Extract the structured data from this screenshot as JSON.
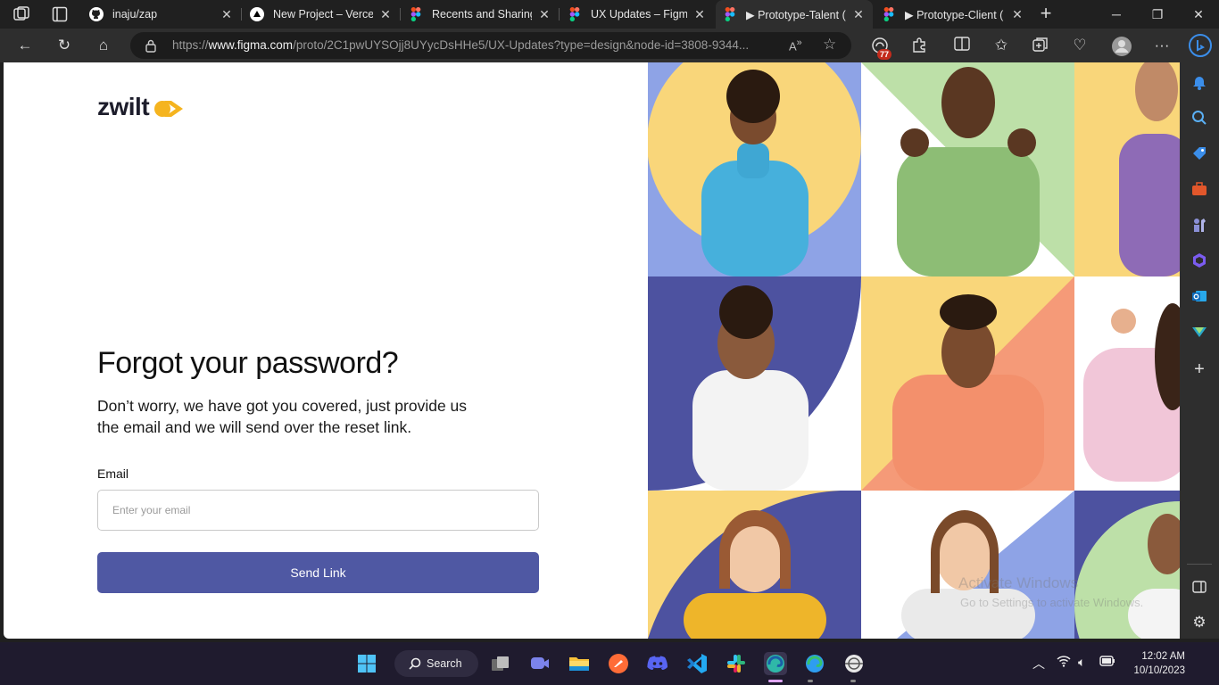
{
  "browser": {
    "tabs": [
      {
        "title": "inaju/zap",
        "favicon": "github-icon",
        "active": false
      },
      {
        "title": "New Project – Vercel",
        "favicon": "vercel-icon",
        "active": false
      },
      {
        "title": "Recents and Sharing",
        "favicon": "figma-icon",
        "active": false
      },
      {
        "title": "UX Updates – Figma",
        "favicon": "figma-icon",
        "active": false
      },
      {
        "title": "▶ Prototype-Talent (",
        "favicon": "figma-icon",
        "active": true
      },
      {
        "title": "▶ Prototype-Client (",
        "favicon": "figma-icon",
        "active": false
      }
    ],
    "url_prefix": "https://",
    "url_host": "www.figma.com",
    "url_path": "/proto/2C1pwUYSOjj8UYycDsHHe5/UX-Updates?type=design&node-id=3808-9344...",
    "extension_badge": "77"
  },
  "page": {
    "logo_text": "zwilt",
    "heading": "Forgot your password?",
    "subtext": "Don’t worry, we have got you covered, just provide us the email and we will send over the reset link.",
    "email_label": "Email",
    "email_placeholder": "Enter your email",
    "email_value": "",
    "button_label": "Send Link",
    "colors": {
      "primary": "#4f58a3",
      "logo_accent": "#f5b41f",
      "tile_yellow": "#f9d67a",
      "tile_blue": "#4d52a0",
      "tile_periwinkle": "#8ea3e6",
      "tile_green": "#bde0a8",
      "tile_salmon": "#f59a78"
    },
    "watermark_title": "Activate Windows",
    "watermark_sub": "Go to Settings to activate Windows."
  },
  "taskbar": {
    "search_label": "Search",
    "time": "12:02 AM",
    "date": "10/10/2023"
  }
}
